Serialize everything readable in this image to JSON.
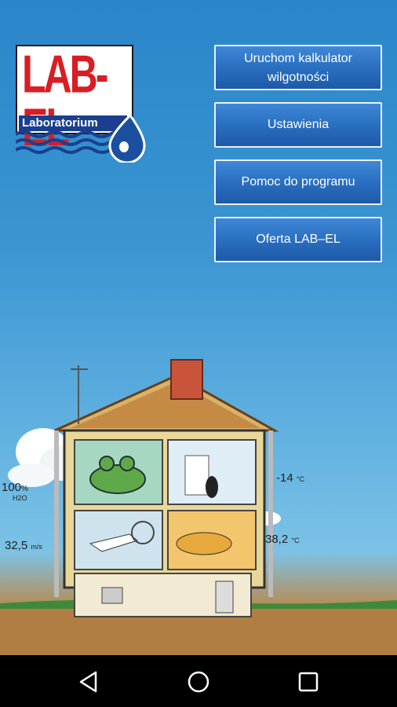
{
  "logo": {
    "brand": "LAB-EL",
    "subtitle": "Laboratorium"
  },
  "menu": {
    "items": [
      {
        "label": "Uruchom kalkulator wilgotności"
      },
      {
        "label": "Ustawienia"
      },
      {
        "label": "Pomoc do programu"
      },
      {
        "label": "Oferta LAB–EL"
      }
    ]
  },
  "illustration": {
    "labels": {
      "humidity": "100",
      "humidity_unit": "%",
      "humidity_sub": "H2O",
      "temp_cold": "-14",
      "temp_cold_unit": "°C",
      "wind": "32,5",
      "wind_unit": "m/s",
      "temp_hot": "38,2",
      "temp_hot_unit": "°C"
    }
  },
  "navbar": {
    "icons": [
      "back-icon",
      "home-icon",
      "recents-icon"
    ]
  }
}
